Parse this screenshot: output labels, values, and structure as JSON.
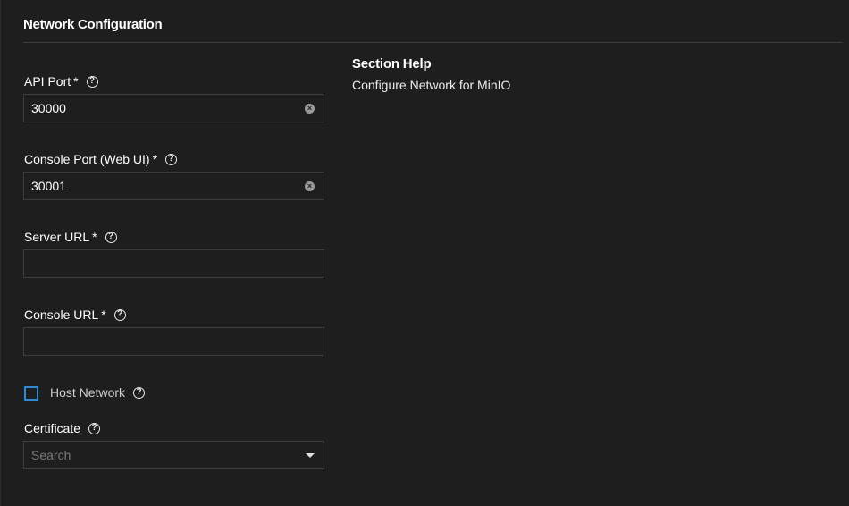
{
  "section": {
    "title": "Network Configuration"
  },
  "help": {
    "title": "Section Help",
    "text": "Configure Network for MinIO"
  },
  "fields": {
    "api_port": {
      "label": "API Port",
      "required_mark": "*",
      "value": "30000"
    },
    "console_port": {
      "label": "Console Port (Web UI)",
      "required_mark": "*",
      "value": "30001"
    },
    "server_url": {
      "label": "Server URL",
      "required_mark": "*",
      "value": ""
    },
    "console_url": {
      "label": "Console URL",
      "required_mark": "*",
      "value": ""
    },
    "host_network": {
      "label": "Host Network",
      "checked": false
    },
    "certificate": {
      "label": "Certificate",
      "placeholder": "Search",
      "value": ""
    }
  },
  "icons": {
    "help": "?",
    "clear": "×"
  },
  "colors": {
    "background": "#1e1e1e",
    "checkbox_border": "#2f89d6"
  }
}
